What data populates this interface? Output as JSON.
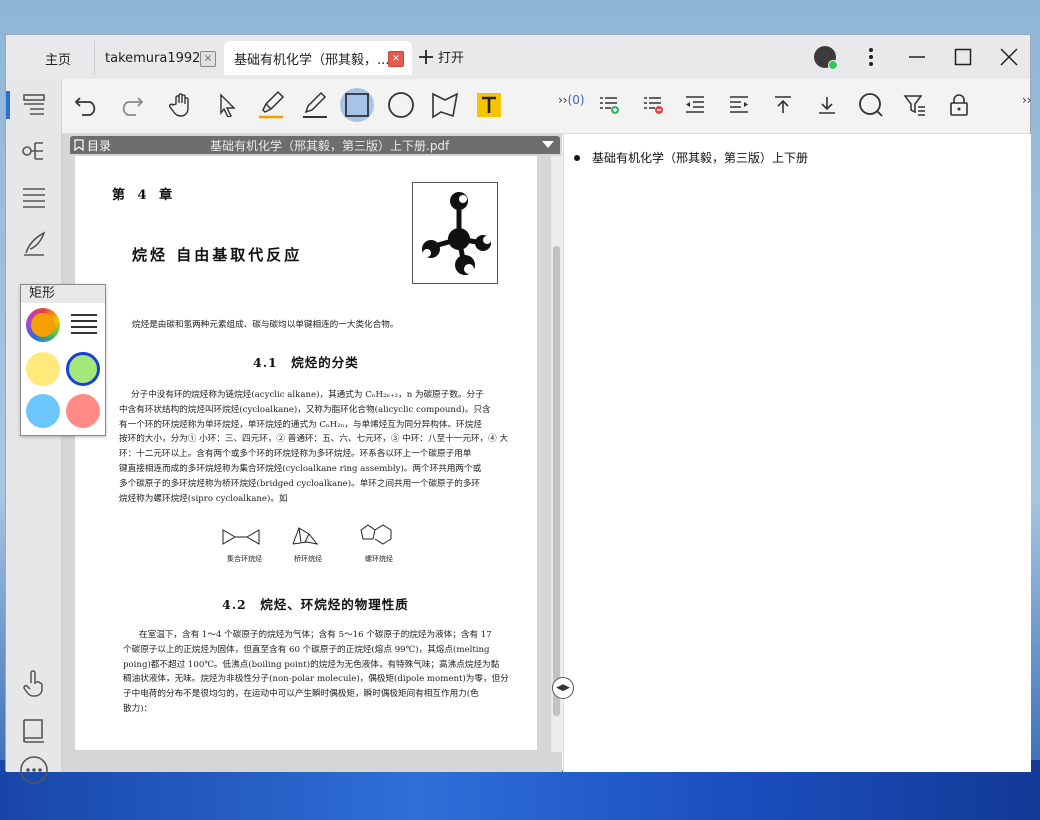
{
  "tabs": {
    "home": "主页",
    "tab1": "takemura19921",
    "tab2": "基础有机化学（邢其毅，...",
    "add": "打开",
    "close_glyph": "×"
  },
  "toolbar": {
    "more_count": "(0)",
    "more_prefix": "››"
  },
  "pdf": {
    "toc_label": "目录",
    "filename": "基础有机化学（邢其毅，第三版）上下册.pdf",
    "chapter": "第 4 章",
    "title": "烷烃 自由基取代反应",
    "intro": "烷烃是由碳和氢两种元素组成、碳与碳均以单键相连的一大类化合物。",
    "sec1": "4.1　烷烃的分类",
    "para1": [
      "分子中没有环的烷烃称为链烷烃(acyclic alkane)，其通式为 CₙH₂ₙ₊₂，n 为碳原子数。分子",
      "中含有环状结构的烷烃叫环烷烃(cycloalkane)，又称为脂环化合物(alicyclic compound)。只含",
      "有一个环的环烷烃称为单环烷烃，单环烷烃的通式为 CₙH₂ₙ，与单烯烃互为同分异构体。环烷烃",
      "按环的大小，分为① 小环：三、四元环，② 普通环：五、六、七元环，③ 中环：八至十一元环，④ 大",
      "环：十二元环以上。含有两个或多个环的环烷烃称为多环烷烃。环系各以环上一个碳原子用单",
      "键直接相连而成的多环烷烃称为集合环烷烃(cycloalkane ring assembly)。两个环共用两个或",
      "多个碳原子的多环烷烃称为桥环烷烃(bridged cycloalkane)。单环之间共用一个碳原子的多环",
      "烷烃称为螺环烷烃(sipro cycloalkane)。如"
    ],
    "captions": [
      "集合环烷烃",
      "桥环烷烃",
      "螺环烷烃"
    ],
    "sec2": "4.2　烷烃、环烷烃的物理性质",
    "para2": [
      "在室温下，含有 1～4 个碳原子的烷烃为气体；含有 5～16 个碳原子的烷烃为液体；含有 17",
      "个碳原子以上的正烷烃为固体，但直至含有 60 个碳原子的正烷烃(熔点 99℃)，其熔点(melting",
      "poing)都不超过 100℃。低沸点(boiling point)的烷烃为无色液体，有特殊气味；高沸点烷烃为黏",
      "稠油状液体，无味。烷烃为非极性分子(non-polar molecule)，偶极矩(dipole moment)为零，但分",
      "子中电荷的分布不是很均匀的，在运动中可以产生瞬时偶极矩，瞬时偶极矩间有相互作用力(色",
      "散力)："
    ]
  },
  "outline": {
    "item1": "基础有机化学（邢其毅，第三版）上下册"
  },
  "popup": {
    "title": "矩形",
    "colors": [
      "#f5a000",
      "#ffe97a",
      "#a5e87a",
      "#6cc5fb",
      "#ff8a86"
    ],
    "selected_border": "#1a3fd8"
  }
}
